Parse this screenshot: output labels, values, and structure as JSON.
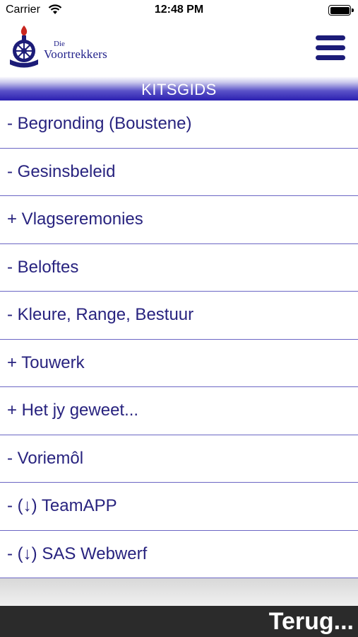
{
  "status_bar": {
    "carrier": "Carrier",
    "time": "12:48 PM",
    "icons": [
      "wifi-icon",
      "battery-icon"
    ]
  },
  "header": {
    "logo_small": "Die",
    "logo_big": "Voortrekkers",
    "menu_icon": "hamburger-menu-icon"
  },
  "title": "KITSGIDS",
  "menu": {
    "items": [
      {
        "label": "- Begronding (Boustene)"
      },
      {
        "label": "- Gesinsbeleid"
      },
      {
        "label": "+ Vlagseremonies"
      },
      {
        "label": "- Beloftes"
      },
      {
        "label": "- Kleure, Range, Bestuur"
      },
      {
        "label": "+ Touwerk"
      },
      {
        "label": "+ Het jy geweet..."
      },
      {
        "label": "- Voriemôl"
      },
      {
        "label": "- (↓) TeamAPP"
      },
      {
        "label": "- (↓) SAS Webwerf"
      }
    ]
  },
  "footer": {
    "back_label": "Terug..."
  },
  "colors": {
    "text": "#28237f",
    "divider": "#6b66c4",
    "title_gradient_end": "#2a1fb0",
    "footer_bg": "#2b2b2b"
  }
}
